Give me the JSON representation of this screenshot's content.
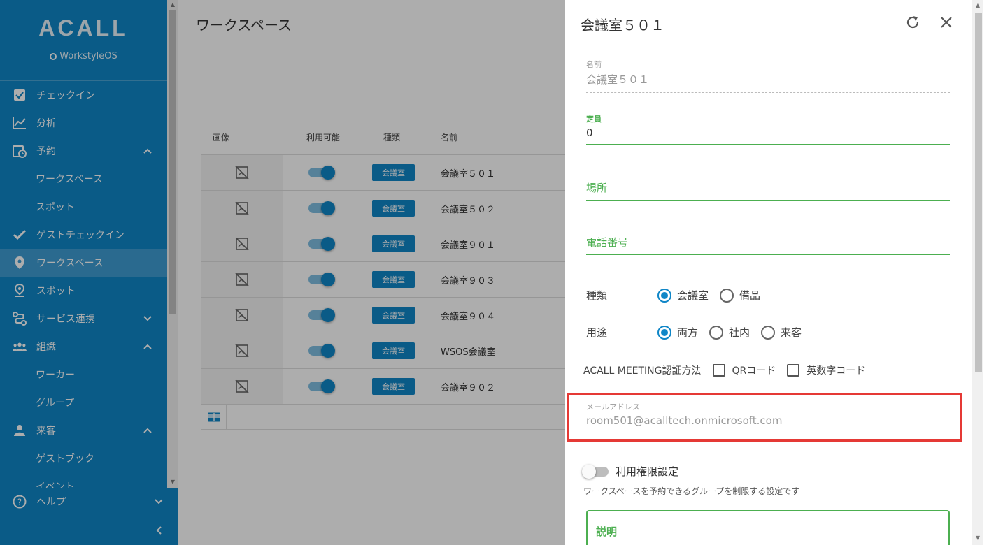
{
  "sidebar": {
    "logo": "ACALL",
    "product": "WorkstyleOS",
    "items": [
      {
        "label": "チェックイン"
      },
      {
        "label": "分析"
      },
      {
        "label": "予約"
      },
      {
        "label": "ワークスペース"
      },
      {
        "label": "スポット"
      },
      {
        "label": "ゲストチェックイン"
      },
      {
        "label": "ワークスペース"
      },
      {
        "label": "スポット"
      },
      {
        "label": "サービス連携"
      },
      {
        "label": "組織"
      },
      {
        "label": "ワーカー"
      },
      {
        "label": "グループ"
      },
      {
        "label": "来客"
      },
      {
        "label": "ゲストブック"
      },
      {
        "label": "イベント"
      }
    ],
    "help": "ヘルプ"
  },
  "main": {
    "title": "ワークスペース",
    "headers": {
      "image": "画像",
      "available": "利用可能",
      "type": "種類",
      "name": "名前"
    },
    "rows": [
      {
        "type": "会議室",
        "name": "会議室５０１"
      },
      {
        "type": "会議室",
        "name": "会議室５０２"
      },
      {
        "type": "会議室",
        "name": "会議室９０１"
      },
      {
        "type": "会議室",
        "name": "会議室９０３"
      },
      {
        "type": "会議室",
        "name": "会議室９０４"
      },
      {
        "type": "会議室",
        "name": "WSOS会議室"
      },
      {
        "type": "会議室",
        "name": "会議室９０２"
      }
    ]
  },
  "panel": {
    "title": "会議室５０１",
    "name_label": "名前",
    "name_value": "会議室５０１",
    "capacity_label": "定員",
    "capacity_value": "0",
    "location_label": "場所",
    "phone_label": "電話番号",
    "kind_label": "種類",
    "kind_options": [
      "会議室",
      "備品"
    ],
    "usage_label": "用途",
    "usage_options": [
      "両方",
      "社内",
      "来客"
    ],
    "auth_label": "ACALL MEETING認証方法",
    "auth_options": [
      "QRコード",
      "英数字コード"
    ],
    "email_label": "メールアドレス",
    "email_value": "room501@acalltech.onmicrosoft.com",
    "permission_label": "利用権限設定",
    "permission_desc": "ワークスペースを予約できるグループを制限する設定です",
    "description_label": "説明"
  },
  "colors": {
    "primary": "#0f86c7",
    "green": "#4caf50",
    "highlight": "#e53935"
  }
}
